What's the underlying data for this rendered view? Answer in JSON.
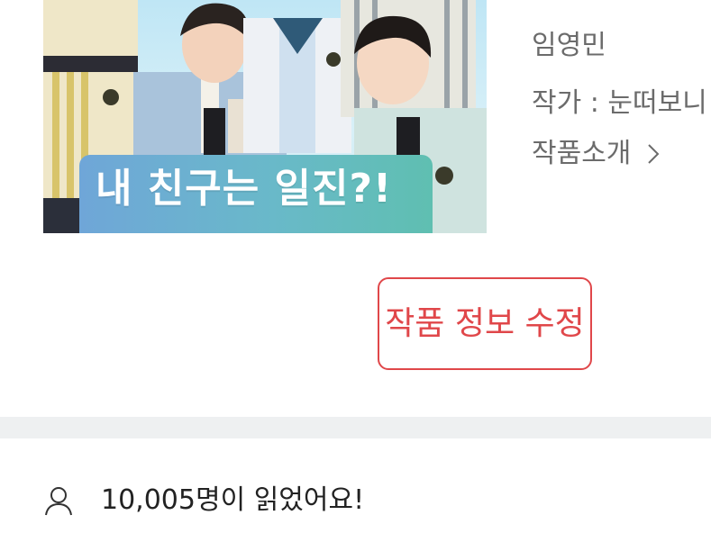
{
  "cover": {
    "title": "내 친구는 일진?!"
  },
  "info": {
    "name": "임영민",
    "author": "작가 : 눈떠보니",
    "intro_label": "작품소개"
  },
  "edit_button": {
    "label": "작품 정보 수정"
  },
  "readers": {
    "text": "10,005명이 읽었어요!"
  },
  "colors": {
    "accent": "#e0474a",
    "muted_text": "#6b6b6b",
    "body_text": "#222222",
    "divider": "#eef0f1"
  },
  "icons": [
    "chevron-right-icon",
    "user-icon"
  ]
}
